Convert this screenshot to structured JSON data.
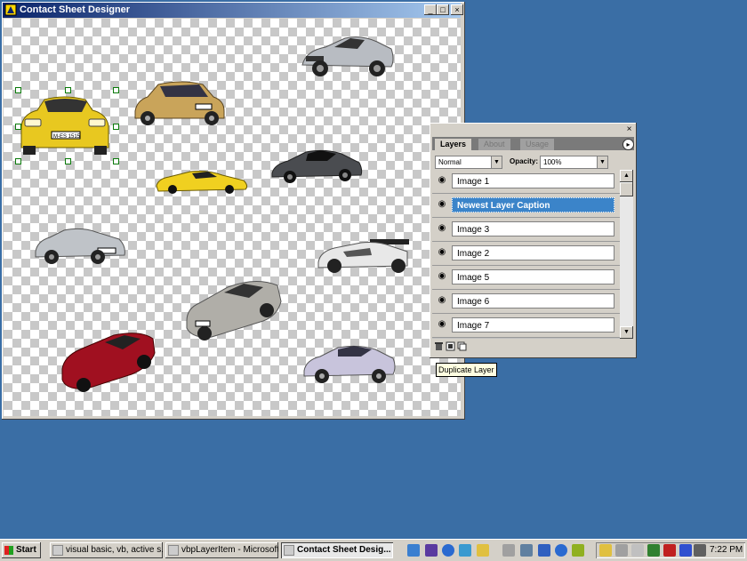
{
  "main_window": {
    "title": "Contact Sheet Designer",
    "minimize_glyph": "_",
    "maximize_glyph": "□",
    "close_glyph": "×"
  },
  "canvas": {
    "cars": [
      {
        "name": "silver-roadster",
        "color": "#b8bcc2"
      },
      {
        "name": "yellow-sedan",
        "color": "#e8c820"
      },
      {
        "name": "gold-sedan",
        "color": "#c9a45a"
      },
      {
        "name": "dark-coupe",
        "color": "#4a4c50"
      },
      {
        "name": "yellow-supercar",
        "color": "#f0d020"
      },
      {
        "name": "silver-roadster-2",
        "color": "#bfc3c8"
      },
      {
        "name": "race-car",
        "color": "#e8e8e8"
      },
      {
        "name": "silver-convertible",
        "color": "#b0aea8"
      },
      {
        "name": "red-sportscar",
        "color": "#a01020"
      },
      {
        "name": "lilac-coupe",
        "color": "#c8c4dc"
      }
    ]
  },
  "layers_palette": {
    "close_glyph": "×",
    "tabs": [
      {
        "label": "Layers",
        "active": true
      },
      {
        "label": "About",
        "active": false
      },
      {
        "label": "Usage",
        "active": false
      }
    ],
    "blend_mode": "Normal",
    "opacity_label": "Opacity:",
    "opacity_value": "100%",
    "layers": [
      {
        "label": "Image 1",
        "selected": false
      },
      {
        "label": "Newest Layer Caption",
        "selected": true
      },
      {
        "label": "Image 3",
        "selected": false
      },
      {
        "label": "Image 2",
        "selected": false
      },
      {
        "label": "Image 5",
        "selected": false
      },
      {
        "label": "Image 6",
        "selected": false
      },
      {
        "label": "Image 7",
        "selected": false
      }
    ],
    "tooltip": "Duplicate Layer"
  },
  "taskbar": {
    "start_label": "Start",
    "buttons": [
      {
        "label": "visual basic, vb, active s...",
        "active": false
      },
      {
        "label": "vbpLayerItem - Microsoft ...",
        "active": false
      },
      {
        "label": "Contact Sheet Desig...",
        "active": true
      }
    ],
    "clock": "7:22 PM"
  },
  "colors": {
    "desktop": "#3a6ea5",
    "titlebar_start": "#0a246a",
    "titlebar_end": "#a6caf0",
    "selection": "#3b84c9"
  }
}
